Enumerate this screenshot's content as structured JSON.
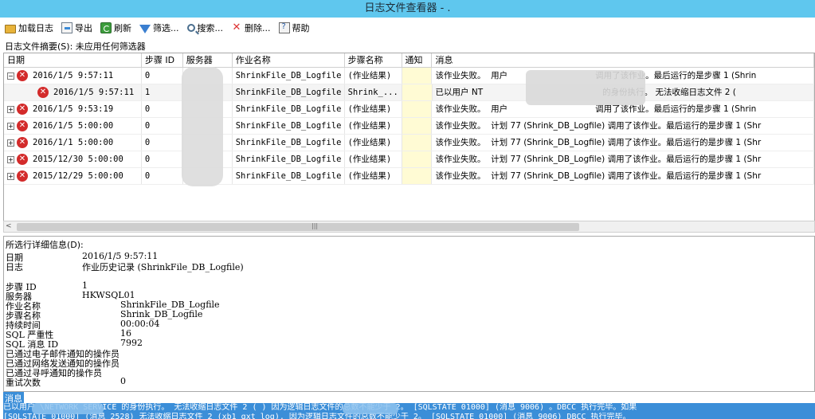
{
  "window": {
    "title": "日志文件查看器 - ."
  },
  "toolbar": {
    "load": "加载日志",
    "export": "导出",
    "refresh": "刷新",
    "filter": "筛选...",
    "search": "搜索...",
    "delete": "删除...",
    "help": "帮助"
  },
  "summary": "日志文件摘要(S): 未应用任何筛选器",
  "grid": {
    "columns": [
      "日期",
      "步骤 ID",
      "服务器",
      "作业名称",
      "步骤名称",
      "通知",
      "消息"
    ],
    "rows": [
      {
        "date": "2016/1/5 9:57:11",
        "step": "0",
        "job": "ShrinkFile_DB_Logfile",
        "stepname": "(作业结果)",
        "msg_a": "该作业失败。",
        "msg_b": "用户",
        "msg_c": "调用了该作业。最后运行的是步骤 1 (Shrin"
      },
      {
        "date": "2016/1/5 9:57:11",
        "step": "1",
        "job": "ShrinkFile_DB_Logfile",
        "stepname": "Shrink_...",
        "msg_a": "已以用户 NT",
        "msg_b": "",
        "msg_c": "的身份执行。 无法收缩日志文件 2 ("
      },
      {
        "date": "2016/1/5 9:53:19",
        "step": "0",
        "job": "ShrinkFile_DB_Logfile",
        "stepname": "(作业结果)",
        "msg_a": "该作业失败。",
        "msg_b": "用户",
        "msg_c": "调用了该作业。最后运行的是步骤 1 (Shrin"
      },
      {
        "date": "2016/1/5 5:00:00",
        "step": "0",
        "job": "ShrinkFile_DB_Logfile",
        "stepname": "(作业结果)",
        "msg_a": "该作业失败。",
        "msg_b": "计划 77 (Shrink_DB_Logfile)",
        "msg_c": "调用了该作业。最后运行的是步骤 1 (Shr"
      },
      {
        "date": "2016/1/1 5:00:00",
        "step": "0",
        "job": "ShrinkFile_DB_Logfile",
        "stepname": "(作业结果)",
        "msg_a": "该作业失败。",
        "msg_b": "计划 77 (Shrink_DB_Logfile)",
        "msg_c": "调用了该作业。最后运行的是步骤 1 (Shr"
      },
      {
        "date": "2015/12/30 5:00:00",
        "step": "0",
        "job": "ShrinkFile_DB_Logfile",
        "stepname": "(作业结果)",
        "msg_a": "该作业失败。",
        "msg_b": "计划 77 (Shrink_DB_Logfile)",
        "msg_c": "调用了该作业。最后运行的是步骤 1 (Shr"
      },
      {
        "date": "2015/12/29 5:00:00",
        "step": "0",
        "job": "ShrinkFile_DB_Logfile",
        "stepname": "(作业结果)",
        "msg_a": "该作业失败。",
        "msg_b": "计划 77 (Shrink_DB_Logfile)",
        "msg_c": "调用了该作业。最后运行的是步骤 1 (Shr"
      }
    ]
  },
  "detail": {
    "title": "所选行详细信息(D):",
    "date_label": "日期",
    "date_value": "2016/1/5 9:57:11",
    "log_label": "日志",
    "log_value": "作业历史记录 (ShrinkFile_DB_Logfile)",
    "stepid_label": "步骤 ID",
    "stepid_value": "1",
    "server_label": "服务器",
    "server_value": "HKWSQL01",
    "job_label": "作业名称",
    "job_value": "ShrinkFile_DB_Logfile",
    "stepname_label": "步骤名称",
    "stepname_value": "Shrink_DB_Logfile",
    "duration_label": "持续时间",
    "duration_value": "00:00:04",
    "severity_label": "SQL 严重性",
    "severity_value": "16",
    "msgid_label": "SQL 消息 ID",
    "msgid_value": "7992",
    "email_label": "已通过电子邮件通知的操作员",
    "net_label": "已通过网络发送通知的操作员",
    "page_label": "已通过寻呼通知的操作员",
    "retry_label": "重试次数",
    "retry_value": "0"
  },
  "message": {
    "label": "消息",
    "line1": "已以用户                \\NETWORK SERVICE 的身份执行。 无法收缩日志文件 2 (            ) 因为逻辑日志文件的总数不能少于 2。 [SQLSTATE 01000] (消息 9006) 。DBCC 执行完毕。如果",
    "line2": "[SQLSTATE 01000] (消息 2528)  无法收缩日志文件 2 (xb1_gxt_log), 因为逻辑日志文件的总数不能少于 2。 [SQLSTATE 01000] (消息 9006)  DBCC 执行完毕。"
  }
}
